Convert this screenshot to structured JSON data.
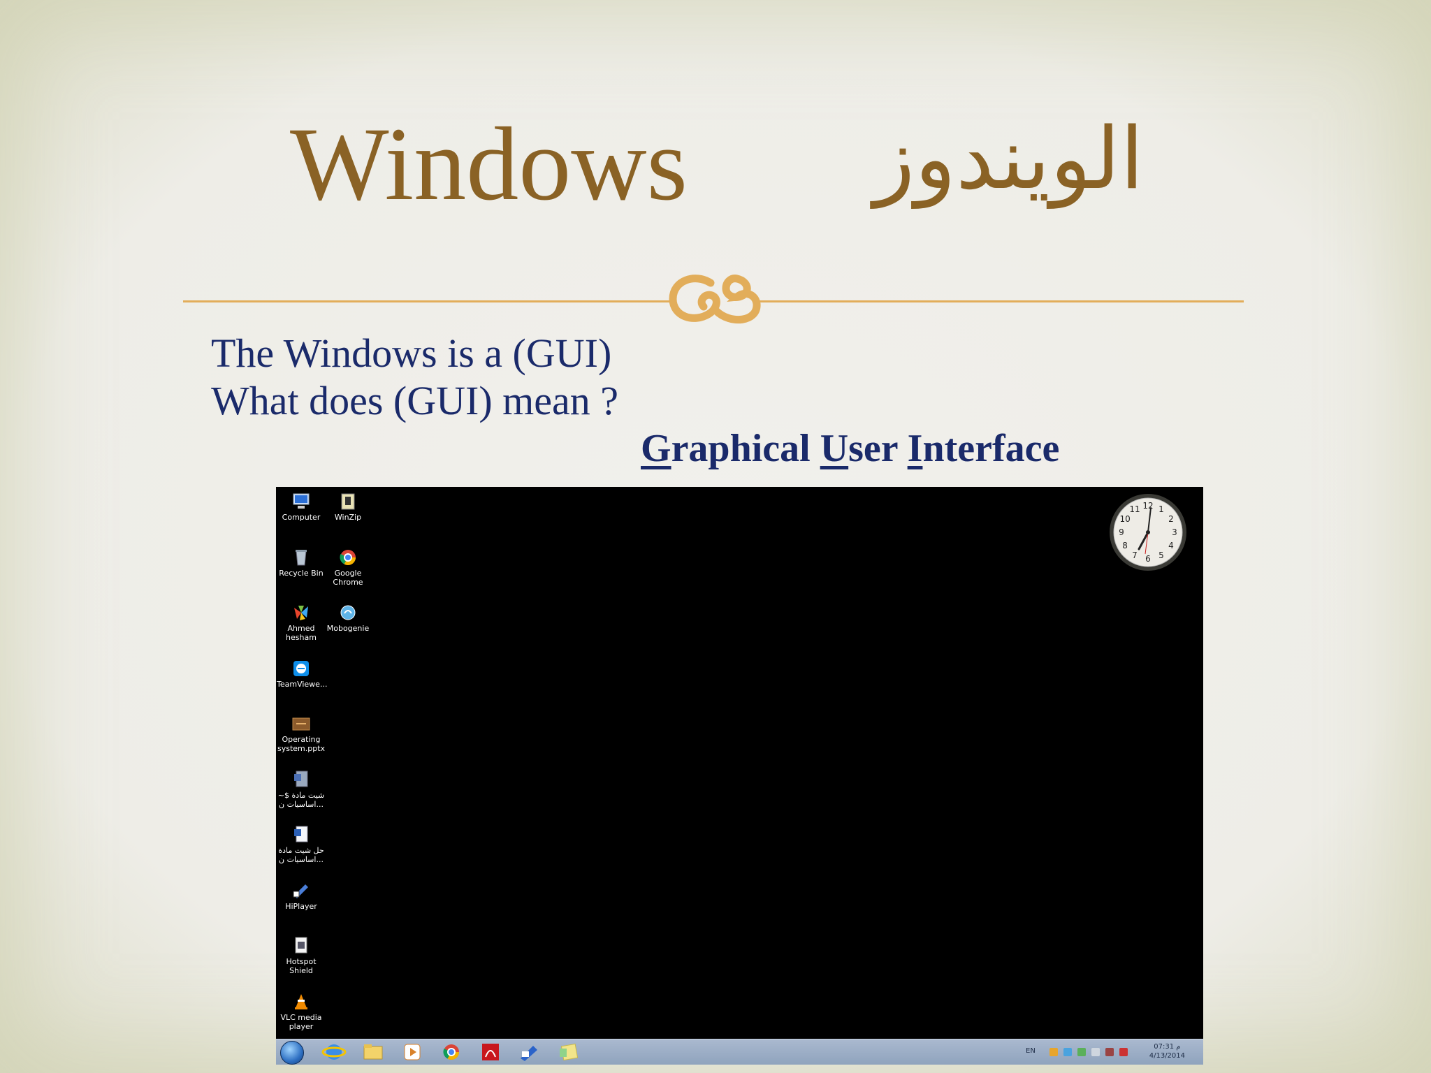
{
  "slide": {
    "title_en": "Windows",
    "title_ar": "الويندوز",
    "line1": "The Windows is a (GUI)",
    "line2": "What does (GUI) mean ?",
    "gui_parts": [
      "G",
      "raphical ",
      "U",
      "ser ",
      "I",
      "nterface"
    ]
  },
  "desktop": {
    "icons": [
      {
        "label": "Computer",
        "icon": "computer-icon"
      },
      {
        "label": "WinZip",
        "icon": "winzip-icon"
      },
      {
        "label": "Recycle Bin",
        "icon": "recycle-bin-icon"
      },
      {
        "label": "Google Chrome",
        "icon": "chrome-icon"
      },
      {
        "label": "Ahmed hesham",
        "icon": "user-folder-icon"
      },
      {
        "label": "Mobogenie",
        "icon": "mobogenie-icon"
      },
      {
        "label": "TeamViewe...",
        "icon": "teamviewer-icon"
      },
      {
        "label": "Operating system.pptx",
        "icon": "pptx-file-icon"
      },
      {
        "label": "~$ شيت مادة اساسيات ن...",
        "icon": "word-file-icon"
      },
      {
        "label": "حل شيت مادة اساسيات ن...",
        "icon": "word-file-icon"
      },
      {
        "label": "HiPlayer",
        "icon": "hiplayer-icon"
      },
      {
        "label": "Hotspot Shield",
        "icon": "hotspot-shield-icon"
      },
      {
        "label": "VLC media player",
        "icon": "vlc-icon"
      }
    ],
    "clock_numbers": [
      "12",
      "1",
      "2",
      "3",
      "4",
      "5",
      "6",
      "7",
      "8",
      "9",
      "10",
      "11"
    ]
  },
  "taskbar": {
    "buttons": [
      "start-button",
      "internet-explorer-icon",
      "file-explorer-icon",
      "media-player-icon",
      "chrome-icon",
      "acrobat-icon",
      "winzip-icon",
      "sticky-notes-icon"
    ],
    "lang": "EN",
    "time": "07:31 م",
    "date": "4/13/2014"
  }
}
